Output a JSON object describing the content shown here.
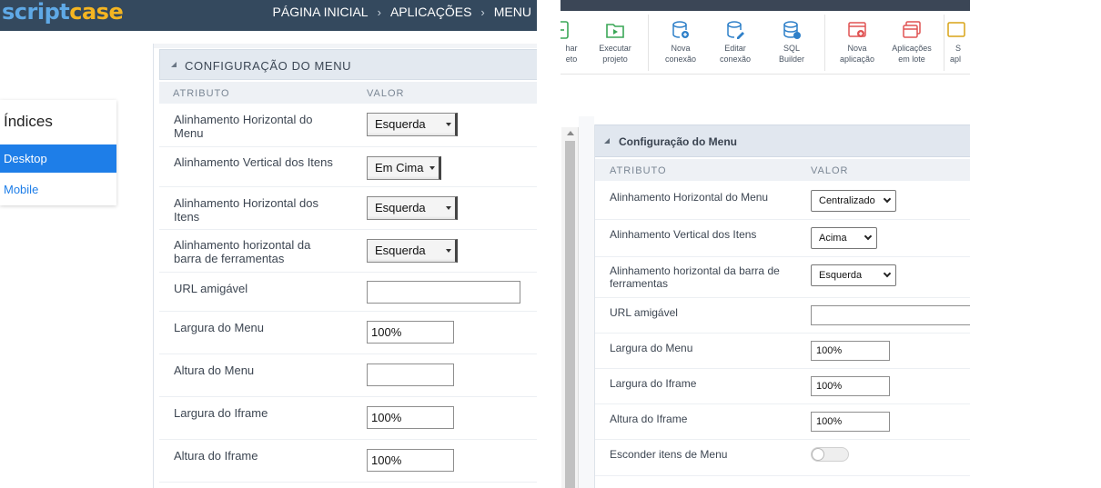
{
  "left": {
    "logo": {
      "part1": "script",
      "part2": "case"
    },
    "nav": {
      "home": "PÁGINA INICIAL",
      "apps": "APLICAÇÕES",
      "menu": "MENU",
      "sep": "›"
    },
    "indices": {
      "title": "Índices",
      "items": [
        "Desktop",
        "Mobile"
      ]
    },
    "panel": {
      "title": "CONFIGURAÇÃO DO MENU",
      "col_attr": "ATRIBUTO",
      "col_value": "VALOR",
      "rows": [
        {
          "label": "Alinhamento Horizontal do Menu",
          "value": "Esquerda"
        },
        {
          "label": "Alinhamento Vertical dos Itens",
          "value": "Em Cima"
        },
        {
          "label": "Alinhamento Horizontal dos Itens",
          "value": "Esquerda"
        },
        {
          "label": "Alinhamento horizontal da barra de ferramentas",
          "value": "Esquerda"
        },
        {
          "label": "URL amigável",
          "value": ""
        },
        {
          "label": "Largura do Menu",
          "value": "100%"
        },
        {
          "label": "Altura do Menu",
          "value": ""
        },
        {
          "label": "Largura do Iframe",
          "value": "100%"
        },
        {
          "label": "Altura do Iframe",
          "value": "100%"
        }
      ]
    }
  },
  "right": {
    "toolbar": [
      {
        "label1": "har",
        "label2": "eto",
        "icon": "document-icon"
      },
      {
        "label1": "Executar",
        "label2": "projeto",
        "icon": "play-folder-icon"
      },
      {
        "label1": "Nova",
        "label2": "conexão",
        "icon": "database-add-icon"
      },
      {
        "label1": "Editar",
        "label2": "conexão",
        "icon": "database-edit-icon"
      },
      {
        "label1": "SQL",
        "label2": "Builder",
        "icon": "database-sql-icon"
      },
      {
        "label1": "Nova",
        "label2": "aplicação",
        "icon": "new-app-icon"
      },
      {
        "label1": "Aplicações",
        "label2": "em lote",
        "icon": "batch-apps-icon"
      },
      {
        "label1": "S",
        "label2": "apl",
        "icon": "app-icon"
      }
    ],
    "panel": {
      "title": "Configuração do Menu",
      "col_attr": "ATRIBUTO",
      "col_value": "VALOR",
      "rows": [
        {
          "label": "Alinhamento Horizontal do Menu",
          "value": "Centralizado"
        },
        {
          "label": "Alinhamento Vertical dos Itens",
          "value": "Acima"
        },
        {
          "label": "Alinhamento horizontal da barra de ferramentas",
          "value": "Esquerda"
        },
        {
          "label": "URL amigável",
          "value": ""
        },
        {
          "label": "Largura do Menu",
          "value": "100%"
        },
        {
          "label": "Largura do Iframe",
          "value": "100%"
        },
        {
          "label": "Altura do Iframe",
          "value": "100%"
        },
        {
          "label": "Esconder itens de Menu",
          "value": "off"
        }
      ]
    }
  },
  "colors": {
    "accent_blue": "#1e7ee8",
    "topbar": "#34495e",
    "logo_blue": "#5fa9e6",
    "logo_yellow": "#f5b521"
  }
}
